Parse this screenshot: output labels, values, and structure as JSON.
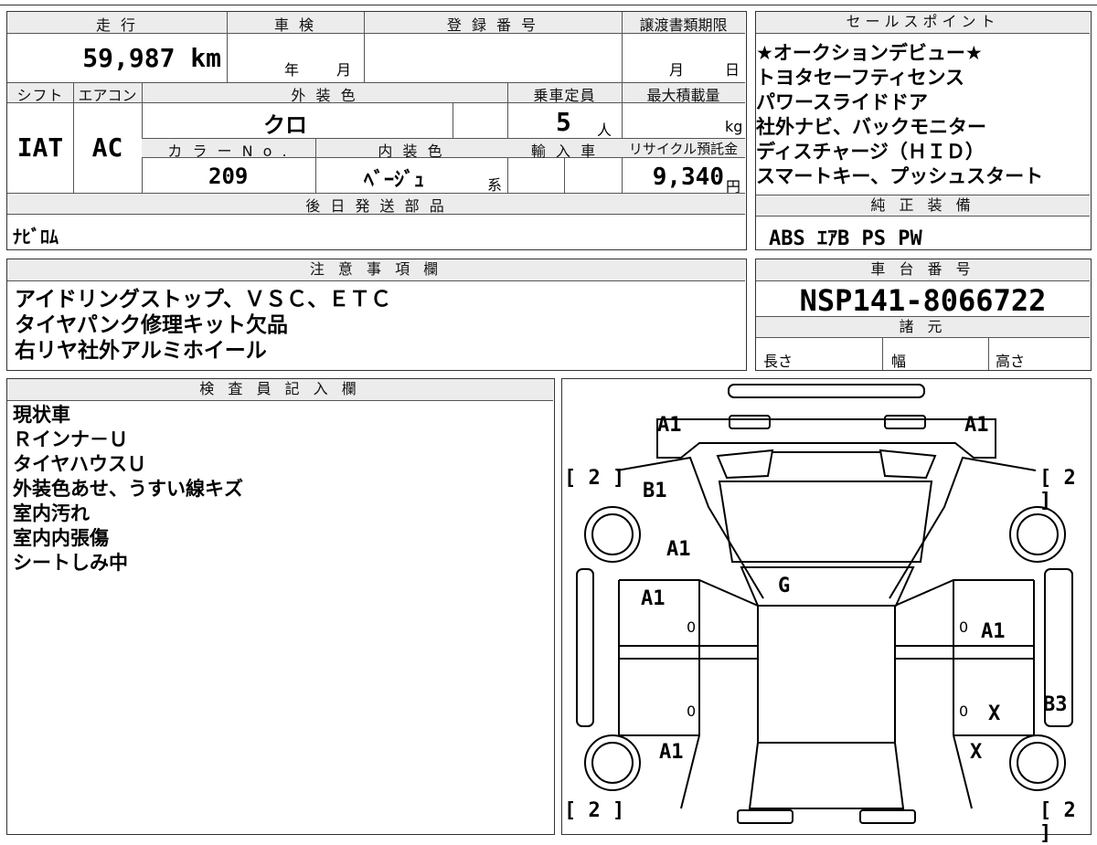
{
  "top_left": {
    "mileage_label": "走 行",
    "mileage_value": "59,987 km",
    "shaken_label": "車 検",
    "year_char": "年",
    "month_char": "月",
    "reg_label": "登 録 番 号",
    "transfer_label": "譲渡書類期限",
    "transfer_month": "月",
    "transfer_day": "日",
    "shift_label": "シフト",
    "shift_value": "IAT",
    "ac_label": "エアコン",
    "ac_value": "AC",
    "ext_color_label": "外 装 色",
    "ext_color_value": "クロ",
    "capacity_label": "乗車定員",
    "capacity_value": "5",
    "capacity_unit": "人",
    "max_load_label": "最大積載量",
    "max_load_unit": "kg",
    "color_no_label": "カ ラ ー N o .",
    "color_no_value": "209",
    "int_color_label": "内 装 色",
    "int_color_value": "ﾍﾞｰｼﾞｭ",
    "int_color_suffix": "系",
    "import_label": "輸 入 車",
    "recycle_label": "リサイクル預託金",
    "recycle_value": "9,340",
    "recycle_unit": "円",
    "later_parts_label": "後 日 発 送 部 品",
    "later_parts_value": "ﾅﾋﾞﾛﾑ"
  },
  "sales_points": {
    "label": "セールスポイント",
    "lines": [
      "★オークションデビュー★",
      "トヨタセーフティセンス",
      "パワースライドドア",
      "社外ナビ、バックモニター",
      "ディスチャージ（ＨＩＤ）",
      "スマートキー、プッシュスタート"
    ]
  },
  "genuine_equipment": {
    "label": "純 正 装 備",
    "value": "ABS ｴｱB PS PW"
  },
  "notes": {
    "label": "注 意 事 項 欄",
    "lines": [
      "アイドリングストップ、ＶＳＣ、ＥＴＣ",
      "タイヤパンク修理キット欠品",
      "右リヤ社外アルミホイール"
    ]
  },
  "chassis": {
    "label": "車 台 番 号",
    "value": "NSP141-8066722",
    "spec_label": "諸 元",
    "length_label": "長さ",
    "width_label": "幅",
    "height_label": "高さ"
  },
  "inspector": {
    "label": "検 査 員 記 入 欄",
    "lines": [
      "現状車",
      "Ｒインナ－Ｕ",
      "タイヤハウスＵ",
      "外装色あせ、うすい線キズ",
      "室内汚れ",
      "室内内張傷",
      "シートしみ中"
    ]
  },
  "diagram": {
    "tire_tl": "[ 2 ]",
    "tire_tr": "[ 2 ]",
    "tire_bl": "[ 2 ]",
    "tire_br": "[ 2 ]",
    "marks": {
      "front_left": "A1",
      "front_right": "A1",
      "fender_left": "B1",
      "hood_left": "A1",
      "windshield": "G",
      "front_door_left": "A1",
      "front_door_right": "A1",
      "rear_door_right": "X",
      "rear_right": "X",
      "rear_fender_left": "A1",
      "rear_quarter_right": "B3"
    },
    "door_zero_1": "0",
    "door_zero_2": "0",
    "door_zero_3": "0",
    "door_zero_4": "0"
  }
}
